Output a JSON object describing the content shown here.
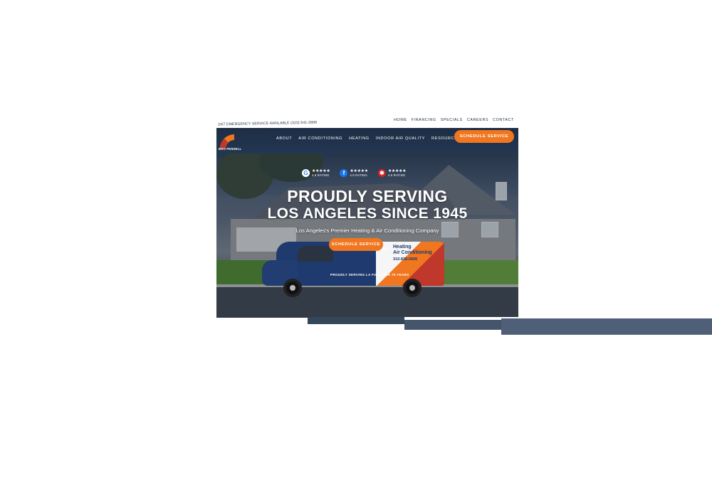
{
  "topbar": {
    "emergency_text": "24/7 EMERGENCY SERVICE AVAILABLE (323) 541-2808",
    "utility_nav": [
      "HOME",
      "FINANCING",
      "SPECIALS",
      "CAREERS",
      "CONTACT"
    ]
  },
  "header": {
    "logo_text": "BRO PENNELL",
    "nav": [
      "ABOUT",
      "AIR CONDITIONING",
      "HEATING",
      "INDOOR AIR QUALITY",
      "RESOURCES"
    ],
    "cta_label": "SCHEDULE SERVICE"
  },
  "hero": {
    "ratings": [
      {
        "icon": "google-icon",
        "stars": "★★★★★",
        "label": "4.8 RATING"
      },
      {
        "icon": "facebook-icon",
        "stars": "★★★★★",
        "label": "4.9 RATING"
      },
      {
        "icon": "yelp-icon",
        "stars": "★★★★★",
        "label": "4.6 RATING"
      }
    ],
    "headline_line1": "PROUDLY SERVING",
    "headline_line2": "LOS ANGELES SINCE 1945",
    "subheadline": "Los Angeles's Premier Heating & Air Conditioning Company",
    "cta_label": "SCHEDULE SERVICE",
    "van": {
      "wordmark": "BRO PENNELL",
      "service_line1": "Heating",
      "service_line2": "Air Conditioning",
      "phone": "310.838.0606",
      "tagline": "PROUDLY SERVING LA FOR OVER 75 YEARS"
    }
  },
  "colors": {
    "navy": "#1d2d44",
    "orange": "#f0761f",
    "red": "#c0372b"
  }
}
